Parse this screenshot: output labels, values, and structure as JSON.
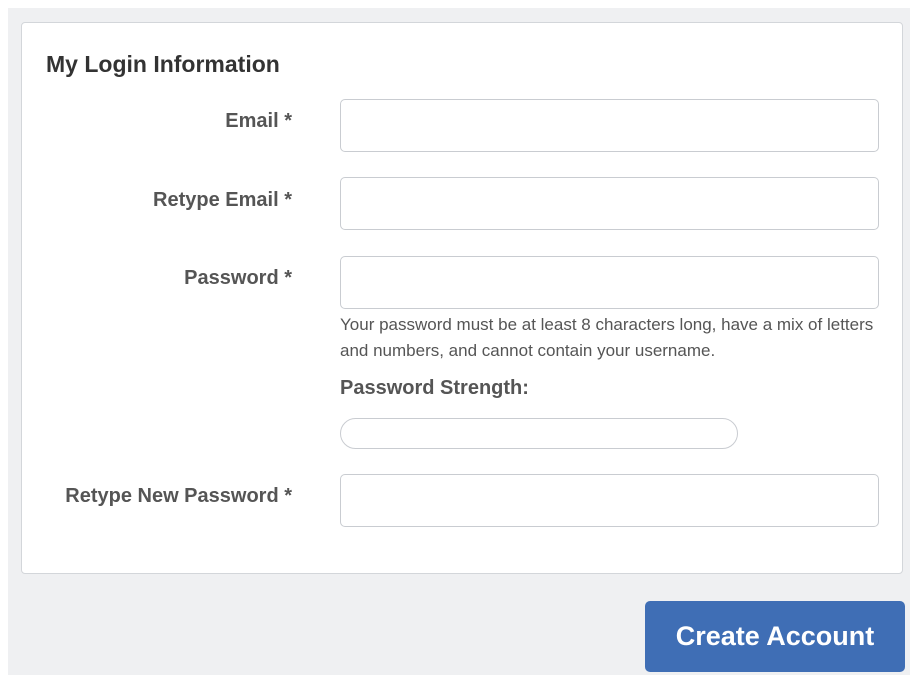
{
  "section": {
    "title": "My Login Information"
  },
  "fields": {
    "email": {
      "label": "Email *",
      "value": "",
      "placeholder": ""
    },
    "retype_email": {
      "label": "Retype Email *",
      "value": "",
      "placeholder": ""
    },
    "password": {
      "label": "Password *",
      "value": "",
      "placeholder": ""
    },
    "retype_password": {
      "label": "Retype New Password *",
      "value": "",
      "placeholder": ""
    }
  },
  "password_help": "Your password must be at least 8 characters long, have a mix of letters and numbers, and cannot contain your username.",
  "password_strength": {
    "label": "Password Strength:",
    "level": 0
  },
  "actions": {
    "create_account_label": "Create Account"
  },
  "colors": {
    "button": "#3f6eb5",
    "page_background": "#eff0f2",
    "card_background": "#ffffff",
    "input_border": "#c9ccd1"
  }
}
